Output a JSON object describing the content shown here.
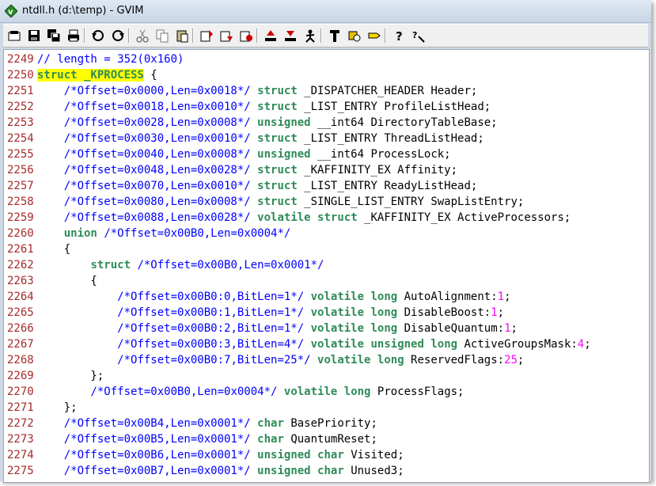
{
  "window": {
    "title": "ntdll.h (d:\\temp) - GVIM",
    "app_icon": "gvim-icon"
  },
  "toolbar": {
    "buttons": [
      {
        "name": "open-icon",
        "sep_after": false
      },
      {
        "name": "save-icon",
        "sep_after": false
      },
      {
        "name": "save-all-icon",
        "sep_after": false
      },
      {
        "name": "print-icon",
        "sep_after": true
      },
      {
        "name": "undo-icon",
        "sep_after": false
      },
      {
        "name": "redo-icon",
        "sep_after": true
      },
      {
        "name": "cut-icon",
        "sep_after": false
      },
      {
        "name": "copy-icon",
        "sep_after": false
      },
      {
        "name": "paste-icon",
        "sep_after": true
      },
      {
        "name": "load-session-icon",
        "sep_after": false
      },
      {
        "name": "save-session-icon",
        "sep_after": false
      },
      {
        "name": "run-script-icon",
        "sep_after": true
      },
      {
        "name": "make-icon",
        "sep_after": false
      },
      {
        "name": "shell-icon",
        "sep_after": false
      },
      {
        "name": "run-ctags-icon",
        "sep_after": true
      },
      {
        "name": "tag-jump-icon",
        "sep_after": false
      },
      {
        "name": "find-help-icon",
        "sep_after": false
      },
      {
        "name": "tag-icon",
        "sep_after": true
      },
      {
        "name": "help-icon",
        "sep_after": false
      },
      {
        "name": "find-help-search-icon",
        "sep_after": false
      }
    ]
  },
  "colors": {
    "line_number": "#a52a2a",
    "comment": "#0000ff",
    "keyword": "#2e8b57",
    "number": "#ff00ff",
    "highlight": "#ffff00"
  },
  "editor": {
    "lines": [
      {
        "n": "2249",
        "segs": [
          {
            "t": "// length = 352(0x160)",
            "c": "cm"
          }
        ]
      },
      {
        "n": "2250",
        "segs": [
          {
            "t": "struct _KPROCESS",
            "c": "kw hl"
          },
          {
            "t": " {",
            "c": ""
          }
        ]
      },
      {
        "n": "2251",
        "segs": [
          {
            "t": "    ",
            "c": ""
          },
          {
            "t": "/*Offset=0x0000,Len=0x0018*/",
            "c": "cm"
          },
          {
            "t": " ",
            "c": ""
          },
          {
            "t": "struct",
            "c": "kw"
          },
          {
            "t": " _DISPATCHER_HEADER Header;",
            "c": ""
          }
        ]
      },
      {
        "n": "2252",
        "segs": [
          {
            "t": "    ",
            "c": ""
          },
          {
            "t": "/*Offset=0x0018,Len=0x0010*/",
            "c": "cm"
          },
          {
            "t": " ",
            "c": ""
          },
          {
            "t": "struct",
            "c": "kw"
          },
          {
            "t": " _LIST_ENTRY ProfileListHead;",
            "c": ""
          }
        ]
      },
      {
        "n": "2253",
        "segs": [
          {
            "t": "    ",
            "c": ""
          },
          {
            "t": "/*Offset=0x0028,Len=0x0008*/",
            "c": "cm"
          },
          {
            "t": " ",
            "c": ""
          },
          {
            "t": "unsigned",
            "c": "kw"
          },
          {
            "t": " __int64 DirectoryTableBase;",
            "c": ""
          }
        ]
      },
      {
        "n": "2254",
        "segs": [
          {
            "t": "    ",
            "c": ""
          },
          {
            "t": "/*Offset=0x0030,Len=0x0010*/",
            "c": "cm"
          },
          {
            "t": " ",
            "c": ""
          },
          {
            "t": "struct",
            "c": "kw"
          },
          {
            "t": " _LIST_ENTRY ThreadListHead;",
            "c": ""
          }
        ]
      },
      {
        "n": "2255",
        "segs": [
          {
            "t": "    ",
            "c": ""
          },
          {
            "t": "/*Offset=0x0040,Len=0x0008*/",
            "c": "cm"
          },
          {
            "t": " ",
            "c": ""
          },
          {
            "t": "unsigned",
            "c": "kw"
          },
          {
            "t": " __int64 ProcessLock;",
            "c": ""
          }
        ]
      },
      {
        "n": "2256",
        "segs": [
          {
            "t": "    ",
            "c": ""
          },
          {
            "t": "/*Offset=0x0048,Len=0x0028*/",
            "c": "cm"
          },
          {
            "t": " ",
            "c": ""
          },
          {
            "t": "struct",
            "c": "kw"
          },
          {
            "t": " _KAFFINITY_EX Affinity;",
            "c": ""
          }
        ]
      },
      {
        "n": "2257",
        "segs": [
          {
            "t": "    ",
            "c": ""
          },
          {
            "t": "/*Offset=0x0070,Len=0x0010*/",
            "c": "cm"
          },
          {
            "t": " ",
            "c": ""
          },
          {
            "t": "struct",
            "c": "kw"
          },
          {
            "t": " _LIST_ENTRY ReadyListHead;",
            "c": ""
          }
        ]
      },
      {
        "n": "2258",
        "segs": [
          {
            "t": "    ",
            "c": ""
          },
          {
            "t": "/*Offset=0x0080,Len=0x0008*/",
            "c": "cm"
          },
          {
            "t": " ",
            "c": ""
          },
          {
            "t": "struct",
            "c": "kw"
          },
          {
            "t": " _SINGLE_LIST_ENTRY SwapListEntry;",
            "c": ""
          }
        ]
      },
      {
        "n": "2259",
        "segs": [
          {
            "t": "    ",
            "c": ""
          },
          {
            "t": "/*Offset=0x0088,Len=0x0028*/",
            "c": "cm"
          },
          {
            "t": " ",
            "c": ""
          },
          {
            "t": "volatile",
            "c": "kw"
          },
          {
            "t": " ",
            "c": ""
          },
          {
            "t": "struct",
            "c": "kw"
          },
          {
            "t": " _KAFFINITY_EX ActiveProcessors;",
            "c": ""
          }
        ]
      },
      {
        "n": "2260",
        "segs": [
          {
            "t": "    ",
            "c": ""
          },
          {
            "t": "union",
            "c": "kw"
          },
          {
            "t": " ",
            "c": ""
          },
          {
            "t": "/*Offset=0x00B0,Len=0x0004*/",
            "c": "cm"
          }
        ]
      },
      {
        "n": "2261",
        "segs": [
          {
            "t": "    {",
            "c": ""
          }
        ]
      },
      {
        "n": "2262",
        "segs": [
          {
            "t": "        ",
            "c": ""
          },
          {
            "t": "struct",
            "c": "kw"
          },
          {
            "t": " ",
            "c": ""
          },
          {
            "t": "/*Offset=0x00B0,Len=0x0001*/",
            "c": "cm"
          }
        ]
      },
      {
        "n": "2263",
        "segs": [
          {
            "t": "        {",
            "c": ""
          }
        ]
      },
      {
        "n": "2264",
        "segs": [
          {
            "t": "            ",
            "c": ""
          },
          {
            "t": "/*Offset=0x00B0:0,BitLen=1*/",
            "c": "cm"
          },
          {
            "t": " ",
            "c": ""
          },
          {
            "t": "volatile",
            "c": "kw"
          },
          {
            "t": " ",
            "c": ""
          },
          {
            "t": "long",
            "c": "kw"
          },
          {
            "t": " AutoAlignment:",
            "c": ""
          },
          {
            "t": "1",
            "c": "num"
          },
          {
            "t": ";",
            "c": ""
          }
        ]
      },
      {
        "n": "2265",
        "segs": [
          {
            "t": "            ",
            "c": ""
          },
          {
            "t": "/*Offset=0x00B0:1,BitLen=1*/",
            "c": "cm"
          },
          {
            "t": " ",
            "c": ""
          },
          {
            "t": "volatile",
            "c": "kw"
          },
          {
            "t": " ",
            "c": ""
          },
          {
            "t": "long",
            "c": "kw"
          },
          {
            "t": " DisableBoost:",
            "c": ""
          },
          {
            "t": "1",
            "c": "num"
          },
          {
            "t": ";",
            "c": ""
          }
        ]
      },
      {
        "n": "2266",
        "segs": [
          {
            "t": "            ",
            "c": ""
          },
          {
            "t": "/*Offset=0x00B0:2,BitLen=1*/",
            "c": "cm"
          },
          {
            "t": " ",
            "c": ""
          },
          {
            "t": "volatile",
            "c": "kw"
          },
          {
            "t": " ",
            "c": ""
          },
          {
            "t": "long",
            "c": "kw"
          },
          {
            "t": " DisableQuantum:",
            "c": ""
          },
          {
            "t": "1",
            "c": "num"
          },
          {
            "t": ";",
            "c": ""
          }
        ]
      },
      {
        "n": "2267",
        "segs": [
          {
            "t": "            ",
            "c": ""
          },
          {
            "t": "/*Offset=0x00B0:3,BitLen=4*/",
            "c": "cm"
          },
          {
            "t": " ",
            "c": ""
          },
          {
            "t": "volatile",
            "c": "kw"
          },
          {
            "t": " ",
            "c": ""
          },
          {
            "t": "unsigned",
            "c": "kw"
          },
          {
            "t": " ",
            "c": ""
          },
          {
            "t": "long",
            "c": "kw"
          },
          {
            "t": " ActiveGroupsMask:",
            "c": ""
          },
          {
            "t": "4",
            "c": "num"
          },
          {
            "t": ";",
            "c": ""
          }
        ]
      },
      {
        "n": "2268",
        "segs": [
          {
            "t": "            ",
            "c": ""
          },
          {
            "t": "/*Offset=0x00B0:7,BitLen=25*/",
            "c": "cm"
          },
          {
            "t": " ",
            "c": ""
          },
          {
            "t": "volatile",
            "c": "kw"
          },
          {
            "t": " ",
            "c": ""
          },
          {
            "t": "long",
            "c": "kw"
          },
          {
            "t": " ReservedFlags:",
            "c": ""
          },
          {
            "t": "25",
            "c": "num"
          },
          {
            "t": ";",
            "c": ""
          }
        ]
      },
      {
        "n": "2269",
        "segs": [
          {
            "t": "        };",
            "c": ""
          }
        ]
      },
      {
        "n": "2270",
        "segs": [
          {
            "t": "        ",
            "c": ""
          },
          {
            "t": "/*Offset=0x00B0,Len=0x0004*/",
            "c": "cm"
          },
          {
            "t": " ",
            "c": ""
          },
          {
            "t": "volatile",
            "c": "kw"
          },
          {
            "t": " ",
            "c": ""
          },
          {
            "t": "long",
            "c": "kw"
          },
          {
            "t": " ProcessFlags;",
            "c": ""
          }
        ]
      },
      {
        "n": "2271",
        "segs": [
          {
            "t": "    };",
            "c": ""
          }
        ]
      },
      {
        "n": "2272",
        "segs": [
          {
            "t": "    ",
            "c": ""
          },
          {
            "t": "/*Offset=0x00B4,Len=0x0001*/",
            "c": "cm"
          },
          {
            "t": " ",
            "c": ""
          },
          {
            "t": "char",
            "c": "kw"
          },
          {
            "t": " BasePriority;",
            "c": ""
          }
        ]
      },
      {
        "n": "2273",
        "segs": [
          {
            "t": "    ",
            "c": ""
          },
          {
            "t": "/*Offset=0x00B5,Len=0x0001*/",
            "c": "cm"
          },
          {
            "t": " ",
            "c": ""
          },
          {
            "t": "char",
            "c": "kw"
          },
          {
            "t": " QuantumReset;",
            "c": ""
          }
        ]
      },
      {
        "n": "2274",
        "segs": [
          {
            "t": "    ",
            "c": ""
          },
          {
            "t": "/*Offset=0x00B6,Len=0x0001*/",
            "c": "cm"
          },
          {
            "t": " ",
            "c": ""
          },
          {
            "t": "unsigned",
            "c": "kw"
          },
          {
            "t": " ",
            "c": ""
          },
          {
            "t": "char",
            "c": "kw"
          },
          {
            "t": " Visited;",
            "c": ""
          }
        ]
      },
      {
        "n": "2275",
        "segs": [
          {
            "t": "    ",
            "c": ""
          },
          {
            "t": "/*Offset=0x00B7,Len=0x0001*/",
            "c": "cm"
          },
          {
            "t": " ",
            "c": ""
          },
          {
            "t": "unsigned",
            "c": "kw"
          },
          {
            "t": " ",
            "c": ""
          },
          {
            "t": "char",
            "c": "kw"
          },
          {
            "t": " Unused3;",
            "c": ""
          }
        ]
      }
    ]
  }
}
